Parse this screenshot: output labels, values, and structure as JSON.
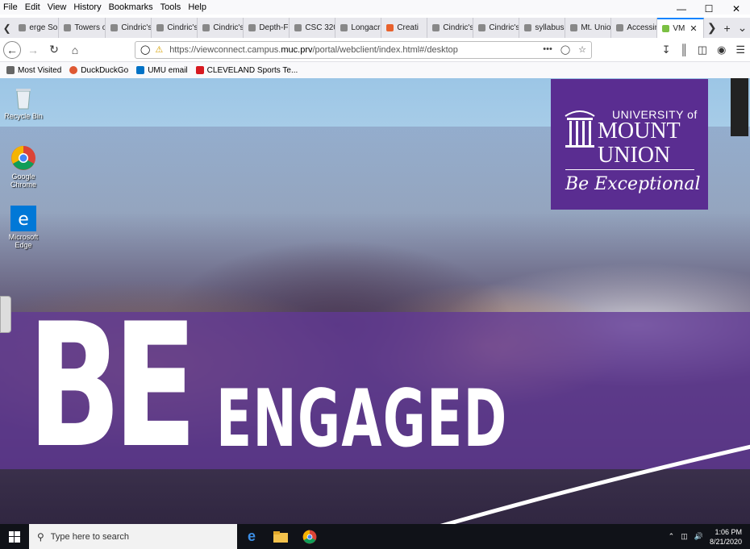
{
  "menu": [
    "File",
    "Edit",
    "View",
    "History",
    "Bookmarks",
    "Tools",
    "Help"
  ],
  "tabs": [
    {
      "label": "erge Sor",
      "color": "#888"
    },
    {
      "label": "Towers of",
      "color": "#888"
    },
    {
      "label": "Cindric's C",
      "color": "#888"
    },
    {
      "label": "Cindric's C",
      "color": "#888"
    },
    {
      "label": "Cindric's C",
      "color": "#888"
    },
    {
      "label": "Depth-Firs",
      "color": "#888"
    },
    {
      "label": "CSC 320 La",
      "color": "#888"
    },
    {
      "label": "Longacre f",
      "color": "#888"
    },
    {
      "label": "Creati",
      "color": "#e8612c"
    },
    {
      "label": "Cindric's C",
      "color": "#888"
    },
    {
      "label": "Cindric's C",
      "color": "#888"
    },
    {
      "label": "syllabus27",
      "color": "#888"
    },
    {
      "label": "Mt. Union",
      "color": "#888"
    },
    {
      "label": "Accessing",
      "color": "#888"
    },
    {
      "label": "VM",
      "color": "#7bc043",
      "active": true
    }
  ],
  "url": {
    "prefix": "https://viewconnect.campus.",
    "domain": "muc.prv",
    "suffix": "/portal/webclient/index.html#/desktop"
  },
  "bookmarks": [
    {
      "label": "Most Visited",
      "icon": "gear-icon",
      "color": "#666"
    },
    {
      "label": "DuckDuckGo",
      "icon": "duckduckgo-icon",
      "color": "#de5833"
    },
    {
      "label": "UMU email",
      "icon": "outlook-icon",
      "color": "#0072c6"
    },
    {
      "label": "CLEVELAND Sports Te...",
      "icon": "cleveland-icon",
      "color": "#d71920"
    }
  ],
  "desktop_icons": [
    {
      "label": "Recycle Bin",
      "icon": "recycle-bin-icon"
    },
    {
      "label": "Google Chrome",
      "icon": "chrome-icon"
    },
    {
      "label": "Microsoft Edge",
      "icon": "edge-icon"
    }
  ],
  "wallpaper": {
    "headline_big": "BE",
    "headline_small": "ENGAGED",
    "logo_line1": "UNIVERSITY of",
    "logo_line2": "MOUNT",
    "logo_line3": "UNION",
    "logo_tagline": "Be Exceptional",
    "brand_color": "#5a2d91"
  },
  "taskbar": {
    "search_placeholder": "Type here to search",
    "time": "1:06 PM",
    "date": "8/21/2020"
  }
}
